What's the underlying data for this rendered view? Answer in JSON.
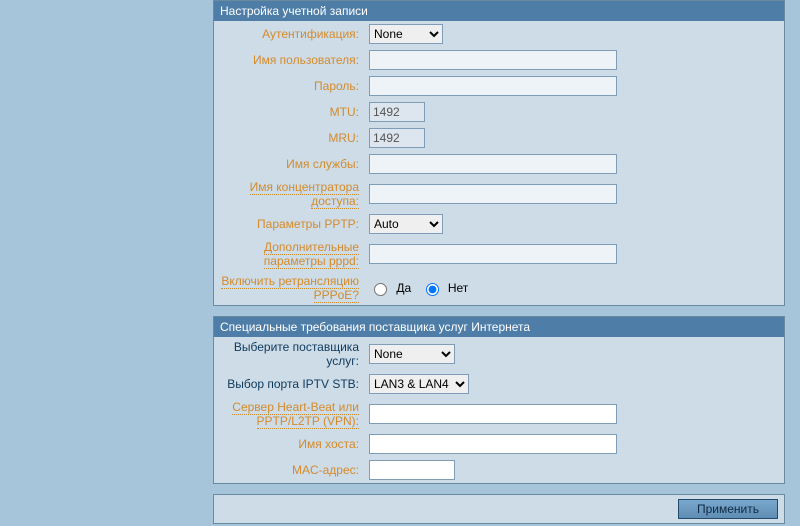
{
  "account": {
    "header": "Настройка учетной записи",
    "auth_label": "Аутентификация:",
    "auth_value": "None",
    "username_label": "Имя пользователя:",
    "username_value": "",
    "password_label": "Пароль:",
    "password_value": "",
    "mtu_label": "MTU:",
    "mtu_value": "1492",
    "mru_label": "MRU:",
    "mru_value": "1492",
    "service_label": "Имя службы:",
    "service_value": "",
    "concentrator_label_l1": "Имя концентратора",
    "concentrator_label_l2": "доступа:",
    "concentrator_value": "",
    "pptp_label": "Параметры PPTP:",
    "pptp_value": "Auto",
    "pppd_label_l1": "Дополнительные",
    "pppd_label_l2": "параметры pppd:",
    "pppd_value": "",
    "relay_label_l1": "Включить ретрансляцию",
    "relay_label_l2": "PPPoE?",
    "relay_yes": "Да",
    "relay_no": "Нет",
    "relay_selected": "no"
  },
  "isp": {
    "header": "Специальные требования поставщика услуг Интернета",
    "provider_label": "Выберите поставщика услуг:",
    "provider_value": "None",
    "iptv_label": "Выбор порта IPTV STB:",
    "iptv_value": "LAN3 & LAN4",
    "heartbeat_label_l1": "Сервер Heart-Beat или",
    "heartbeat_label_l2": "PPTP/L2TP (VPN):",
    "heartbeat_value": "",
    "hostname_label": "Имя хоста:",
    "hostname_value": "",
    "mac_label": "MAC-адрес:",
    "mac_value": ""
  },
  "footer": {
    "apply": "Применить"
  }
}
